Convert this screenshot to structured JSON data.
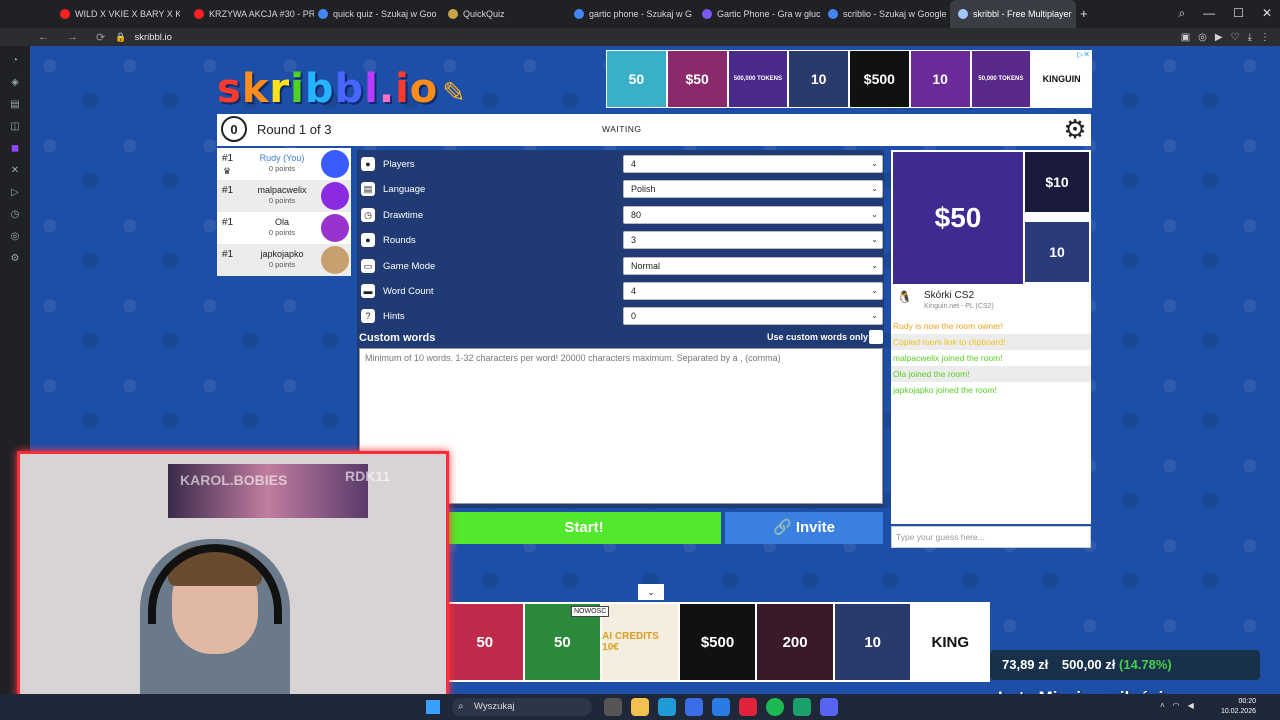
{
  "browser": {
    "tabs": [
      {
        "label": "WILD X VKIE X BARY X KA",
        "color": "#ff2020"
      },
      {
        "label": "KRZYWA AKCJA #30 - PR",
        "color": "#ff2020"
      },
      {
        "label": "quick quiz - Szukaj w Goo",
        "color": "#4285f4"
      },
      {
        "label": "QuickQuiz",
        "color": "#caa44a"
      },
      {
        "label": "gartic phone - Szukaj w G",
        "color": "#4285f4"
      },
      {
        "label": "Gartic Phone - Gra w głuc",
        "color": "#7a5af0"
      },
      {
        "label": "scriblio - Szukaj w Google",
        "color": "#4285f4"
      },
      {
        "label": "skribbl - Free Multiplayer",
        "color": "#a0c8ff"
      }
    ],
    "new_tab": "+",
    "url": "skribbl.io"
  },
  "game": {
    "logo": [
      "s",
      "k",
      "r",
      "i",
      "b",
      "b",
      "l",
      ".",
      "i",
      "o"
    ],
    "logo_colors": [
      "#ff3a2d",
      "#ff8d1b",
      "#ffe11b",
      "#4ed61e",
      "#25b5ff",
      "#4a64ff",
      "#b83bff",
      "#ff6ec7",
      "#ff3a2d",
      "#ff8d1b"
    ],
    "timer": "0",
    "round_label": "Round 1 of 3",
    "status": "WAITING",
    "players": [
      {
        "rank": "#1",
        "name": "Rudy (You)",
        "points": "0 points",
        "color": "#3a5cff",
        "me": true
      },
      {
        "rank": "#1",
        "name": "malpacwelix",
        "points": "0 points",
        "color": "#8a2be2",
        "me": false
      },
      {
        "rank": "#1",
        "name": "Ola",
        "points": "0 points",
        "color": "#9a32cd",
        "me": false
      },
      {
        "rank": "#1",
        "name": "japkojapko",
        "points": "0 points",
        "color": "#c8a070",
        "me": false
      }
    ],
    "settings": [
      {
        "label": "Players",
        "value": "4",
        "icon": "person-icon"
      },
      {
        "label": "Language",
        "value": "Polish",
        "icon": "language-icon"
      },
      {
        "label": "Drawtime",
        "value": "80",
        "icon": "clock-icon"
      },
      {
        "label": "Rounds",
        "value": "3",
        "icon": "rounds-icon"
      },
      {
        "label": "Game Mode",
        "value": "Normal",
        "icon": "gamemode-icon"
      },
      {
        "label": "Word Count",
        "value": "4",
        "icon": "wordcount-icon"
      },
      {
        "label": "Hints",
        "value": "0",
        "icon": "hint-icon"
      }
    ],
    "custom_words": {
      "title": "Custom words",
      "only_label": "Use custom words only",
      "placeholder": "Minimum of 10 words. 1-32 characters per word! 20000 characters maximum. Separated by a , (comma)"
    },
    "start_label": "Start!",
    "invite_label": "🔗 Invite",
    "chat": [
      {
        "text": "Rudy is now the room owner!",
        "color": "#f0a020"
      },
      {
        "text": "Copied room link to clipboard!",
        "color": "#f0c020"
      },
      {
        "text": "malpacwelix joined the room!",
        "color": "#56ce27"
      },
      {
        "text": "Ola joined the room!",
        "color": "#56ce27"
      },
      {
        "text": "japkojapko joined the room!",
        "color": "#56ce27"
      }
    ],
    "guess_placeholder": "Type your guess here..."
  },
  "ads": {
    "top_tiles": [
      "50",
      "$50",
      "500,000 TOKENS",
      "10",
      "$500",
      "10",
      "50,000 TOKENS",
      "KINGUIN"
    ],
    "right_big": "$50",
    "right_small1": "$10",
    "right_small2": "10",
    "right_title": "Skórki CS2",
    "right_sub": "Kinguin.net - PL (CS2)",
    "bottom_tiles": [
      "50",
      "50",
      "AI CREDITS 10€",
      "$500",
      "200",
      "10",
      "KING"
    ],
    "bottom_nowosc": "NOWOŚĆ"
  },
  "stream": {
    "poster_text": "KAROL.BOBIES",
    "yt_text": "RDK11",
    "money": {
      "a": "73,89 zł",
      "b": "500,00 zł",
      "pct": "(14.78%)"
    },
    "title": "Luty Miesiąc miłości"
  },
  "taskbar": {
    "search": "Wyszukaj",
    "time": "00:20",
    "date": "10.02.2026"
  }
}
